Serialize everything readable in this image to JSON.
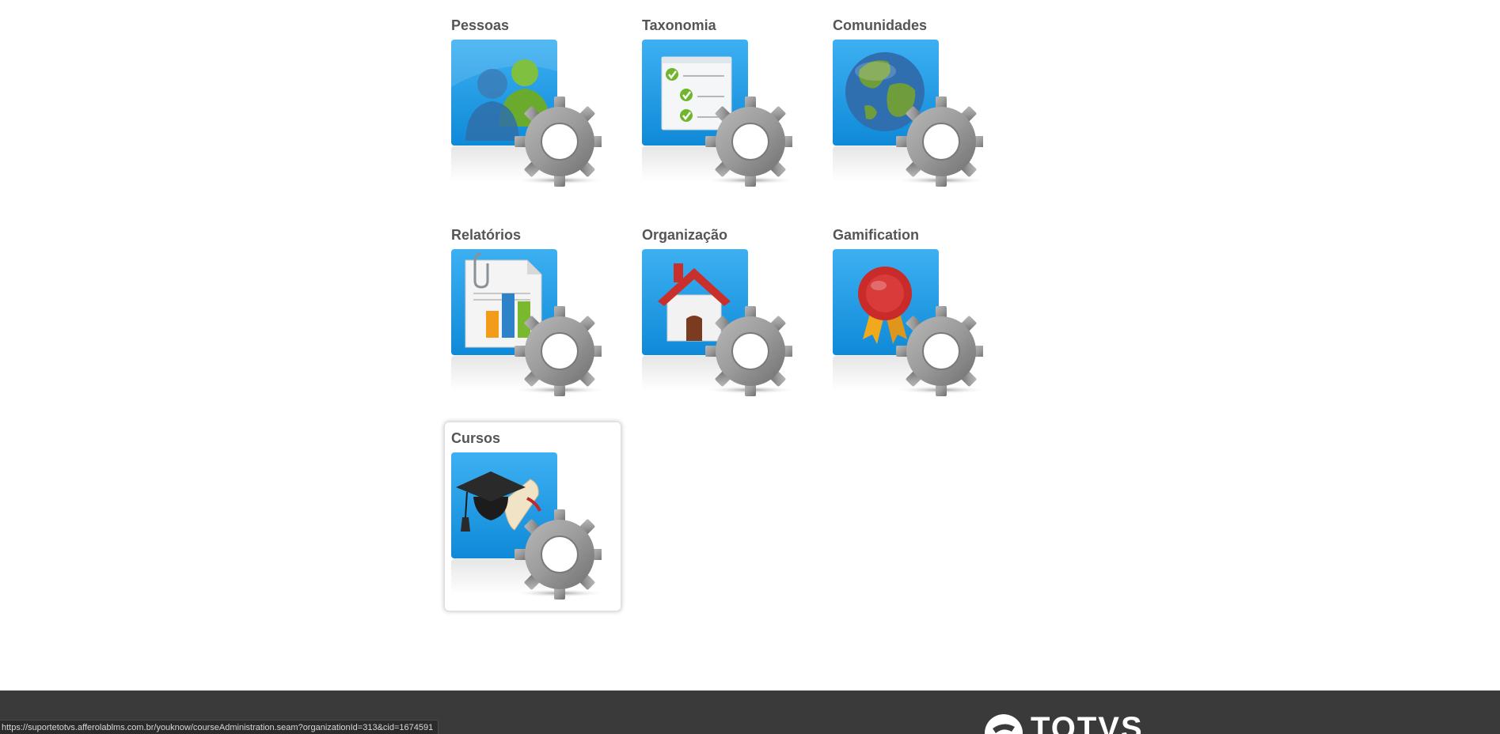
{
  "tiles": [
    {
      "label": "Pessoas",
      "icon": "people-icon"
    },
    {
      "label": "Taxonomia",
      "icon": "checklist-icon"
    },
    {
      "label": "Comunidades",
      "icon": "globe-icon"
    },
    {
      "label": "Relatórios",
      "icon": "report-chart-icon"
    },
    {
      "label": "Organização",
      "icon": "house-icon"
    },
    {
      "label": "Gamification",
      "icon": "award-seal-icon"
    },
    {
      "label": "Cursos",
      "icon": "graduation-cap-icon"
    }
  ],
  "selected_tile": "Cursos",
  "status_bar": {
    "url": "https://suportetotvs.afferolablms.com.br/youknow/courseAdministration.seam?organizationId=313&cid=1674591"
  },
  "footer": {
    "brand": "TOTVS"
  },
  "colors": {
    "tile_blue": "#1c9be6",
    "label_gray": "#555555",
    "footer_bg": "#3a3a3a",
    "gear_gray": "#8e8e8e"
  }
}
